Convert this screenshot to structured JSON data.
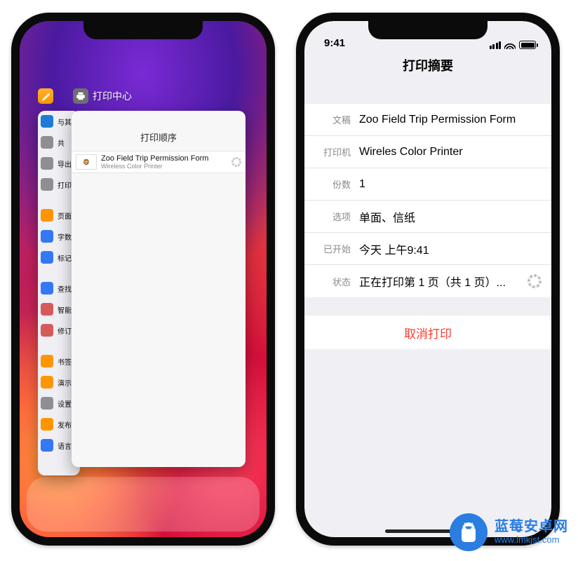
{
  "left": {
    "switcher": {
      "back_label": "",
      "front_label": "打印中心",
      "print_center": {
        "title": "打印顺序",
        "job": {
          "document": "Zoo Field Trip Permission Form",
          "printer": "Wireless Color Printer"
        }
      },
      "sidebar_items": [
        {
          "label": "与其",
          "color": "#1e7bd6"
        },
        {
          "label": "共",
          "color": "#8e8e93"
        },
        {
          "label": "导出",
          "color": "#8e8e93"
        },
        {
          "label": "打印",
          "color": "#8e8e93"
        },
        {
          "label": "页面",
          "color": "#ff9500"
        },
        {
          "label": "字数",
          "color": "#3478f6"
        },
        {
          "label": "标记",
          "color": "#3478f6"
        },
        {
          "label": "查找",
          "color": "#3478f6"
        },
        {
          "label": "智能",
          "color": "#d65a5a"
        },
        {
          "label": "修订",
          "color": "#d65a5a"
        },
        {
          "label": "书签",
          "color": "#ff9500"
        },
        {
          "label": "演示",
          "color": "#ff9500"
        },
        {
          "label": "设置",
          "color": "#8e8e93"
        },
        {
          "label": "发布",
          "color": "#ff9500"
        },
        {
          "label": "语言",
          "color": "#3478f6"
        }
      ]
    }
  },
  "right": {
    "status_time": "9:41",
    "nav_title": "打印摘要",
    "rows": {
      "document": {
        "label": "文稿",
        "value": "Zoo Field Trip Permission Form"
      },
      "printer": {
        "label": "打印机",
        "value": "Wireles Color Printer"
      },
      "copies": {
        "label": "份数",
        "value": "1"
      },
      "options": {
        "label": "选项",
        "value": "单面、信纸"
      },
      "started": {
        "label": "已开始",
        "value": "今天 上午9:41"
      },
      "status": {
        "label": "状态",
        "value": "正在打印第 1 页（共 1 页）..."
      }
    },
    "cancel_label": "取消打印"
  },
  "watermark": {
    "title": "蓝莓安卓网",
    "url": "www.lmkjst.com"
  }
}
